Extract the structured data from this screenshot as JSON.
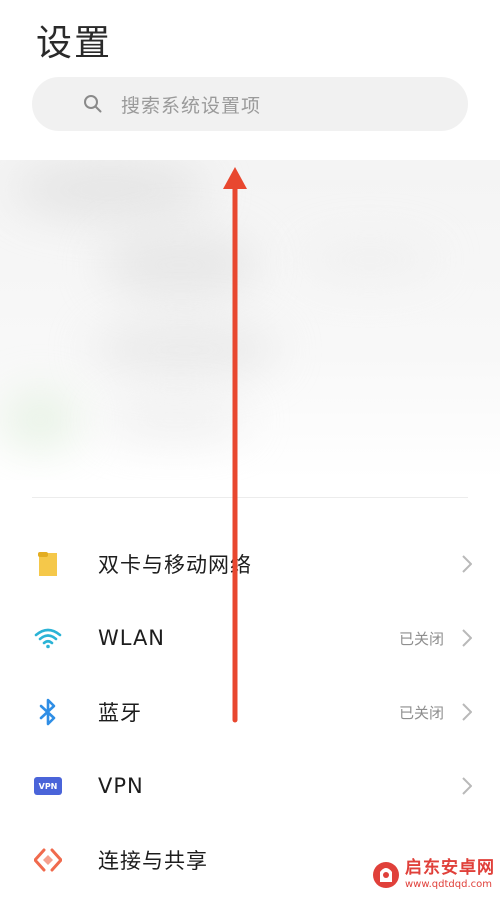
{
  "page": {
    "title": "设置"
  },
  "search": {
    "placeholder": "搜索系统设置项",
    "icon": "search-icon"
  },
  "settings_items": [
    {
      "label": "双卡与移动网络",
      "status": "",
      "icon": "sim-card-icon",
      "icon_color": "#f3c13a"
    },
    {
      "label": "WLAN",
      "status": "已关闭",
      "icon": "wifi-icon",
      "icon_color": "#2bb3d6"
    },
    {
      "label": "蓝牙",
      "status": "已关闭",
      "icon": "bluetooth-icon",
      "icon_color": "#2f8ee5"
    },
    {
      "label": "VPN",
      "status": "",
      "icon": "vpn-icon",
      "icon_color": "#4a64d9",
      "icon_text": "VPN"
    },
    {
      "label": "连接与共享",
      "status": "",
      "icon": "connection-sharing-icon",
      "icon_color": "#f06a4d"
    }
  ],
  "annotation": {
    "arrow_color": "#e8472f",
    "arrow_direction": "up"
  },
  "watermark": {
    "title": "启东安卓网",
    "url": "www.qdtdqd.com",
    "color": "#e0403a"
  }
}
